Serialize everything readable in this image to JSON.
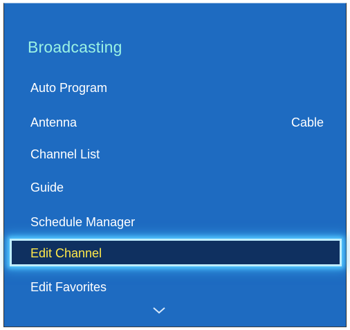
{
  "menu": {
    "title": "Broadcasting",
    "items": [
      {
        "label": "Auto Program",
        "value": ""
      },
      {
        "label": "Antenna",
        "value": "Cable"
      },
      {
        "label": "Channel List",
        "value": ""
      },
      {
        "label": "Guide",
        "value": ""
      },
      {
        "label": "Schedule Manager",
        "value": ""
      },
      {
        "label": "Edit Channel",
        "value": "",
        "selected": true
      },
      {
        "label": "Edit Favorites",
        "value": ""
      }
    ],
    "scroll_icon": "chevron-down-icon"
  },
  "colors": {
    "panel_background": "#1e6bc1",
    "title_text": "#9af2e4",
    "item_text": "#ffffff",
    "selected_text": "#ffe84a",
    "selected_background": "#0f3060",
    "selected_glow": "#55c8ff"
  }
}
